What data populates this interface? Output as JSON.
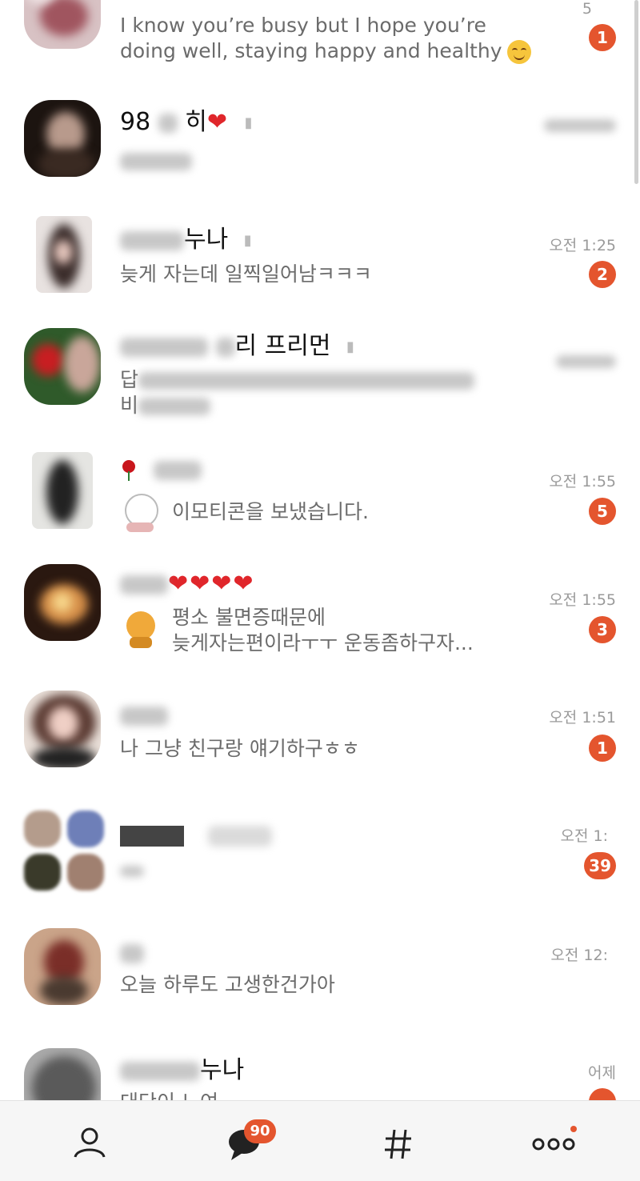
{
  "chats": [
    {
      "preview_line1": "I know you’re busy but I hope you’re",
      "preview_line2": "doing well, staying happy and healthy",
      "time": "5",
      "badge": "1"
    },
    {
      "name_visible": "98",
      "name_tail": "히",
      "hearts": "❤",
      "time": ""
    },
    {
      "name_visible": "누나",
      "preview": "늦게 자는데 일찍일어남ㅋㅋㅋ",
      "time": "오전 1:25",
      "badge": "2"
    },
    {
      "name_visible": "리 프리먼",
      "preview_line1": "답",
      "preview_line2": "비",
      "time": ""
    },
    {
      "name_icon": "rose-icon",
      "preview": "이모티콘을 보냈습니다.",
      "time": "오전 1:55",
      "badge": "5"
    },
    {
      "name_visible": "❤❤❤❤",
      "preview_line1": "평소 불면증때문에",
      "preview_line2": "늦게자는편이라ㅜㅜ 운동좀하구자...",
      "time": "오전 1:55",
      "badge": "3"
    },
    {
      "preview": "나 그냥 친구랑 얘기하구ㅎㅎ",
      "time": "오전 1:51",
      "badge": "1"
    },
    {
      "time": "오전 1:",
      "badge": "39"
    },
    {
      "preview": "오늘 하루도 고생한건가아",
      "time": "오전 12:"
    },
    {
      "name_visible": "누나",
      "preview": "대단이 느여",
      "time": "어제"
    }
  ],
  "tabbar": {
    "chats_badge": "90",
    "friends_icon": "person-icon",
    "chats_icon": "chat-bubble-icon",
    "openchat_icon": "hash-icon",
    "more_icon": "more-icon"
  },
  "colors": {
    "badge": "#e4552e",
    "heart": "#e0262b"
  }
}
